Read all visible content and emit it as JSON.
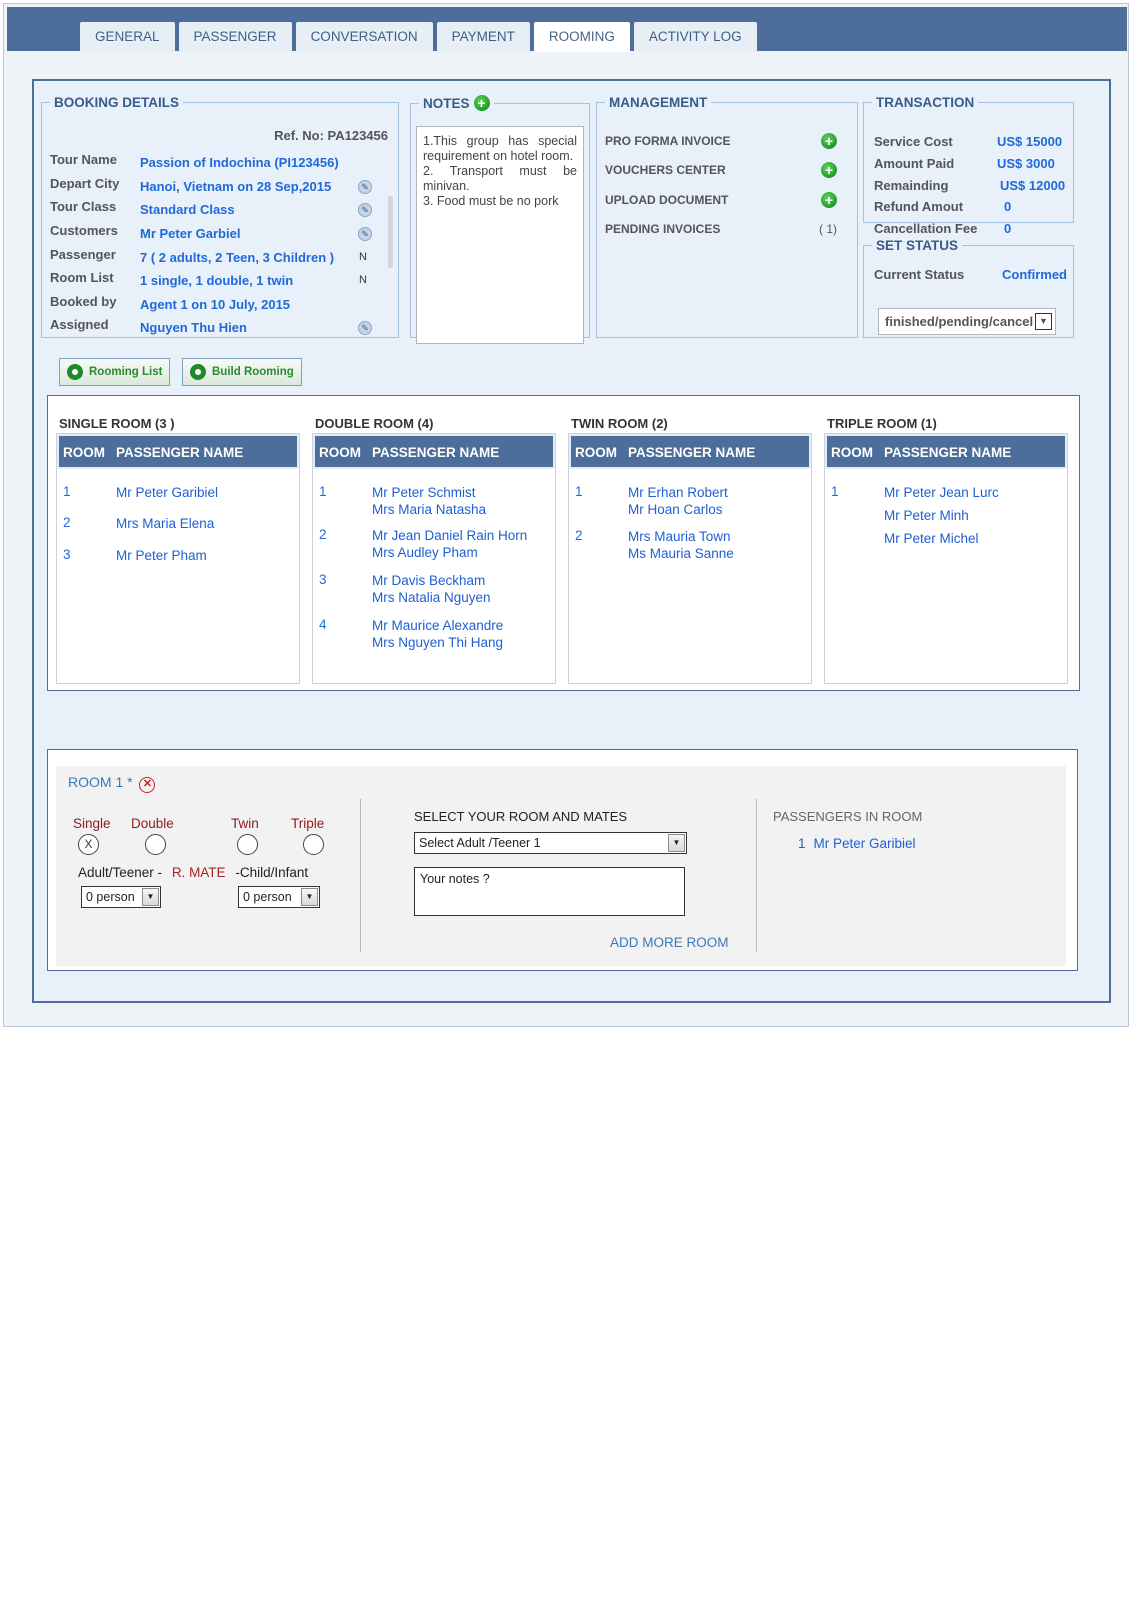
{
  "tabs": [
    {
      "label": "GENERAL"
    },
    {
      "label": "PASSENGER"
    },
    {
      "label": "CONVERSATION"
    },
    {
      "label": "PAYMENT"
    },
    {
      "label": "ROOMING",
      "active": true
    },
    {
      "label": "ACTIVITY LOG"
    }
  ],
  "booking": {
    "title": "BOOKING DETAILS",
    "ref": "Ref. No: PA123456",
    "rows": [
      {
        "label": "Tour Name",
        "value": "Passion of Indochina (PI123456)",
        "flag": ""
      },
      {
        "label": "Depart City",
        "value": "Hanoi, Vietnam on 28 Sep,2015",
        "flag": "edit-icon"
      },
      {
        "label": "Tour Class",
        "value": "Standard Class",
        "flag": "edit-icon"
      },
      {
        "label": "Customers",
        "value": "Mr Peter Garbiel",
        "flag": "edit-icon"
      },
      {
        "label": "Passenger",
        "value": "7  ( 2 adults, 2 Teen, 3 Children )",
        "flag": "N"
      },
      {
        "label": "Room List",
        "value": "1 single, 1 double, 1 twin",
        "flag": "N"
      },
      {
        "label": "Booked by",
        "value": "Agent 1  on 10 July, 2015",
        "flag": ""
      },
      {
        "label": "Assigned",
        "value": "Nguyen Thu Hien",
        "flag": "edit-icon"
      }
    ]
  },
  "notes": {
    "title": "NOTES",
    "text": "1.This group has special requirement on hotel room.\n2. Transport must be minivan.\n3. Food must be no pork"
  },
  "management": {
    "title": "MANAGEMENT",
    "items": [
      {
        "label": "PRO FORMA INVOICE",
        "extra": ""
      },
      {
        "label": "VOUCHERS CENTER",
        "extra": ""
      },
      {
        "label": "UPLOAD DOCUMENT",
        "extra": ""
      },
      {
        "label": "PENDING INVOICES",
        "extra": "( 1)"
      }
    ]
  },
  "transaction": {
    "title": "TRANSACTION",
    "rows": [
      {
        "label": "Service Cost",
        "value": "US$ 15000"
      },
      {
        "label": "Amount Paid",
        "value": "US$ 3000"
      },
      {
        "label": "Remainding",
        "value": "US$ 12000"
      },
      {
        "label": "Refund Amout",
        "value": "0"
      },
      {
        "label": "Cancellation Fee",
        "value": "0"
      }
    ]
  },
  "status": {
    "title": "SET STATUS",
    "label": "Current Status",
    "value": "Confirmed",
    "select": "finished/pending/cancel"
  },
  "buttons": {
    "rooming_list": "Rooming List",
    "build_rooming": "Build Rooming"
  },
  "room_table_headers": {
    "room": "ROOM",
    "name": "PASSENGER NAME"
  },
  "rooms": [
    {
      "title": "SINGLE ROOM (3 )",
      "rows": [
        {
          "num": "1",
          "names": [
            "Mr Peter Garibiel"
          ]
        },
        {
          "num": "2",
          "names": [
            "Mrs Maria Elena"
          ]
        },
        {
          "num": "3",
          "names": [
            "Mr Peter Pham"
          ]
        }
      ]
    },
    {
      "title": "DOUBLE  ROOM  (4)",
      "rows": [
        {
          "num": "1",
          "names": [
            "Mr Peter Schmist",
            "Mrs  Maria Natasha"
          ]
        },
        {
          "num": "2",
          "names": [
            "Mr Jean Daniel Rain Horn",
            "Mrs Audley Pham"
          ]
        },
        {
          "num": "3",
          "names": [
            "Mr Davis Beckham",
            "Mrs Natalia Nguyen"
          ]
        },
        {
          "num": "4",
          "names": [
            "Mr Maurice Alexandre",
            "Mrs Nguyen Thi Hang"
          ]
        }
      ]
    },
    {
      "title": "TWIN  ROOM (2)",
      "rows": [
        {
          "num": "1",
          "names": [
            "Mr Erhan Robert",
            "Mr  Hoan Carlos"
          ]
        },
        {
          "num": "2",
          "names": [
            "Mrs Mauria Town",
            "Ms  Mauria Sanne"
          ]
        }
      ]
    },
    {
      "title": "TRIPLE ROOM (1)",
      "rows": [
        {
          "num": "1",
          "names": [
            "Mr Peter Jean Lurc",
            "Mr Peter Minh",
            "Mr Peter Michel"
          ]
        }
      ]
    }
  ],
  "builder": {
    "room_label": "ROOM 1 *",
    "types": [
      "Single",
      "Double",
      "Twin",
      "Triple"
    ],
    "selected_type": "Single",
    "selected_mark": "X",
    "adult_label": "Adult/Teener -",
    "mate_label": "R. MATE",
    "child_label": "-Child/Infant",
    "adult_count": "0 person",
    "child_count": "0 person",
    "select_title": "SELECT YOUR ROOM AND MATES",
    "select_value": "Select Adult /Teener 1",
    "notes_placeholder": "Your notes ?",
    "add_more": "ADD MORE ROOM",
    "passengers_title": "PASSENGERS  IN ROOM",
    "passengers": [
      {
        "num": "1",
        "name": "Mr Peter Garibiel"
      }
    ]
  }
}
